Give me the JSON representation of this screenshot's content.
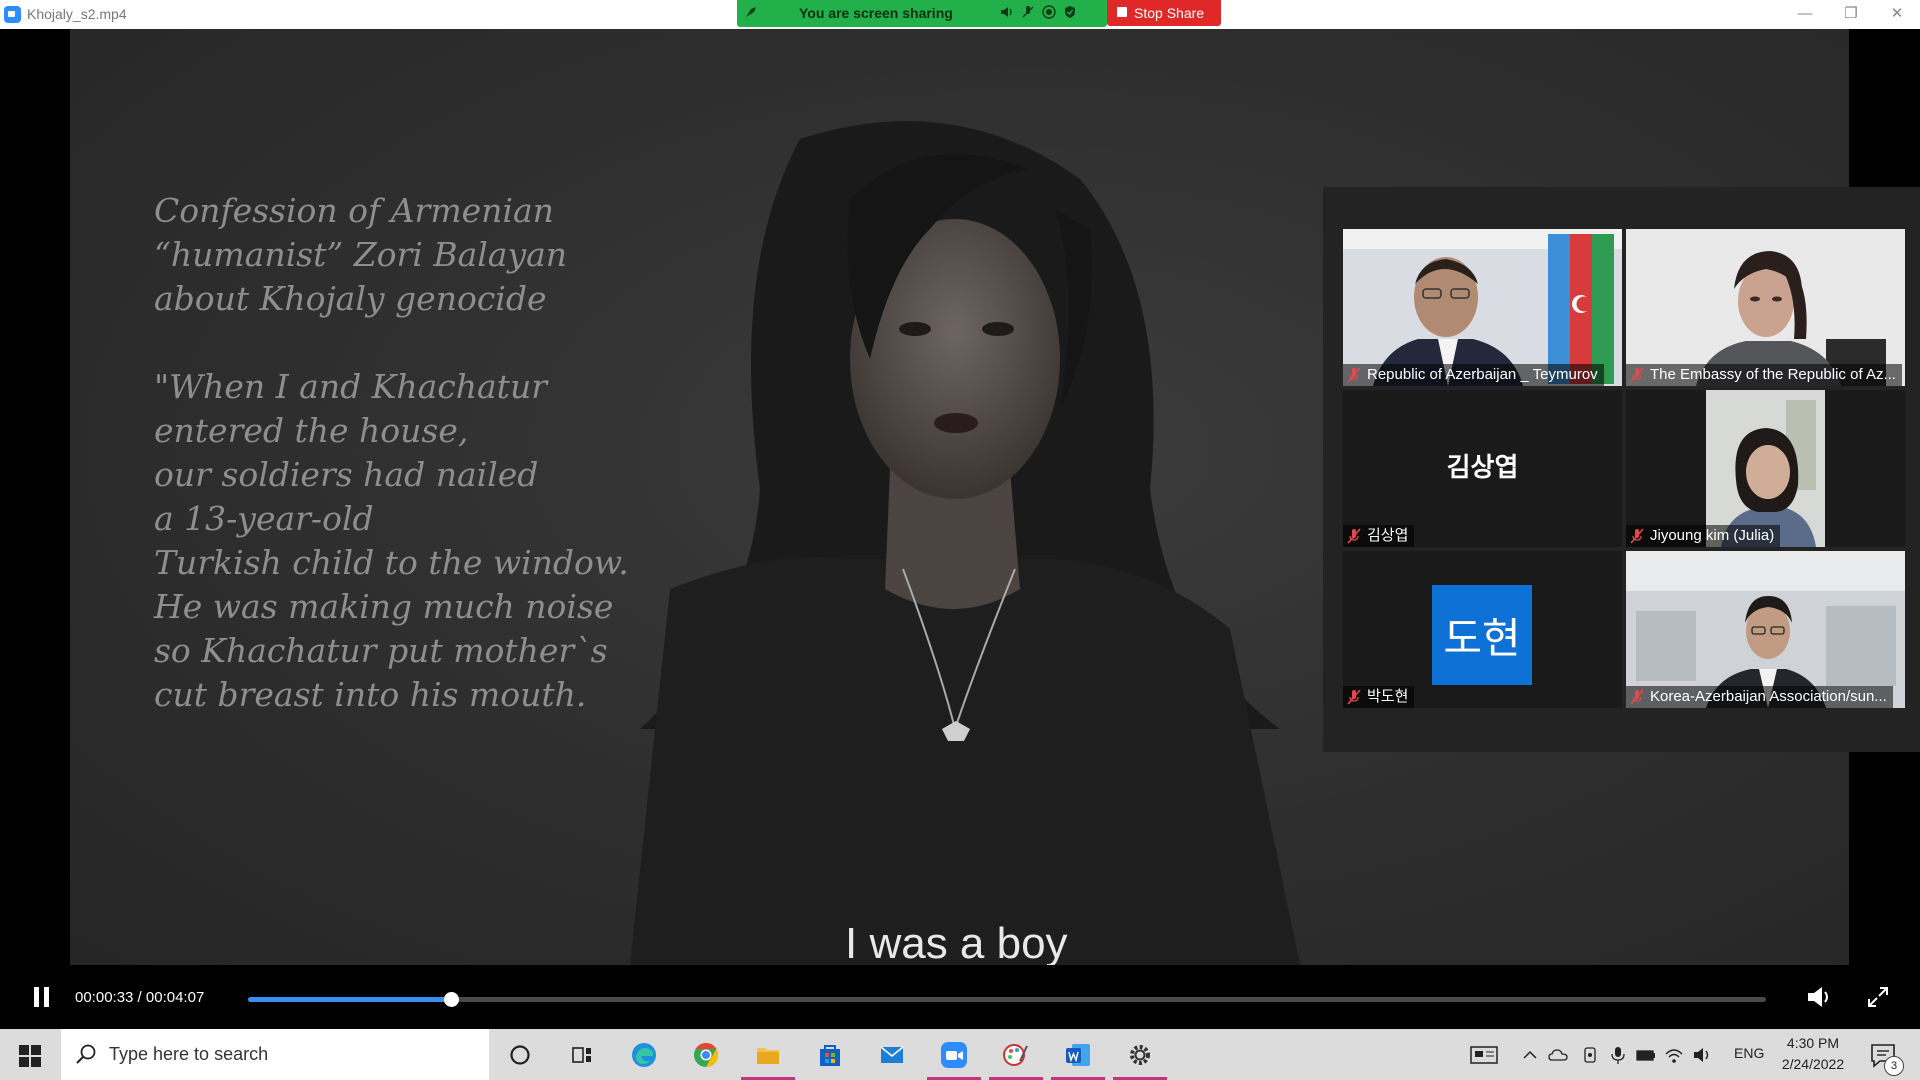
{
  "window": {
    "title": "Khojaly_s2.mp4",
    "minimize": "—",
    "maximize": "❐",
    "close": "✕"
  },
  "share_banner": {
    "status": "You are screen sharing",
    "stop_label": "Stop Share"
  },
  "video": {
    "heading_lines": [
      "Confession of Armenian",
      "“humanist” Zori Balayan",
      "about Khojaly genocide"
    ],
    "quote_lines": [
      "\"When I and Khachatur",
      "entered the house,",
      "our soldiers had nailed",
      "a 13-year-old",
      "Turkish child to the window.",
      "He was making much noise",
      "so Khachatur put mother`s",
      "cut breast into his mouth."
    ],
    "subtitle": "I was a boy"
  },
  "participants": [
    {
      "name": "Republic of Azerbaijan _ Teymurov",
      "muted": true,
      "view": "video"
    },
    {
      "name": "The Embassy of the Republic of Az...",
      "muted": true,
      "view": "video"
    },
    {
      "name": "김상엽",
      "muted": true,
      "view": "initials",
      "initials": "김상엽"
    },
    {
      "name": "Jiyoung kim (Julia)",
      "muted": true,
      "view": "video"
    },
    {
      "name": "박도현",
      "muted": true,
      "view": "avatar",
      "initials": "도현"
    },
    {
      "name": "Korea-Azerbaijan Association/sun...",
      "muted": true,
      "view": "video"
    }
  ],
  "player": {
    "time": "00:00:33 / 00:04:07",
    "progress": 0.1336
  },
  "taskbar": {
    "search_placeholder": "Type here to search",
    "apps": [
      "cortana",
      "task-view",
      "edge",
      "chrome",
      "file-explorer",
      "store",
      "mail",
      "zoom",
      "paint",
      "word",
      "settings"
    ],
    "language": "ENG",
    "time": "4:30 PM",
    "date": "2/24/2022",
    "notification_count": "3"
  }
}
